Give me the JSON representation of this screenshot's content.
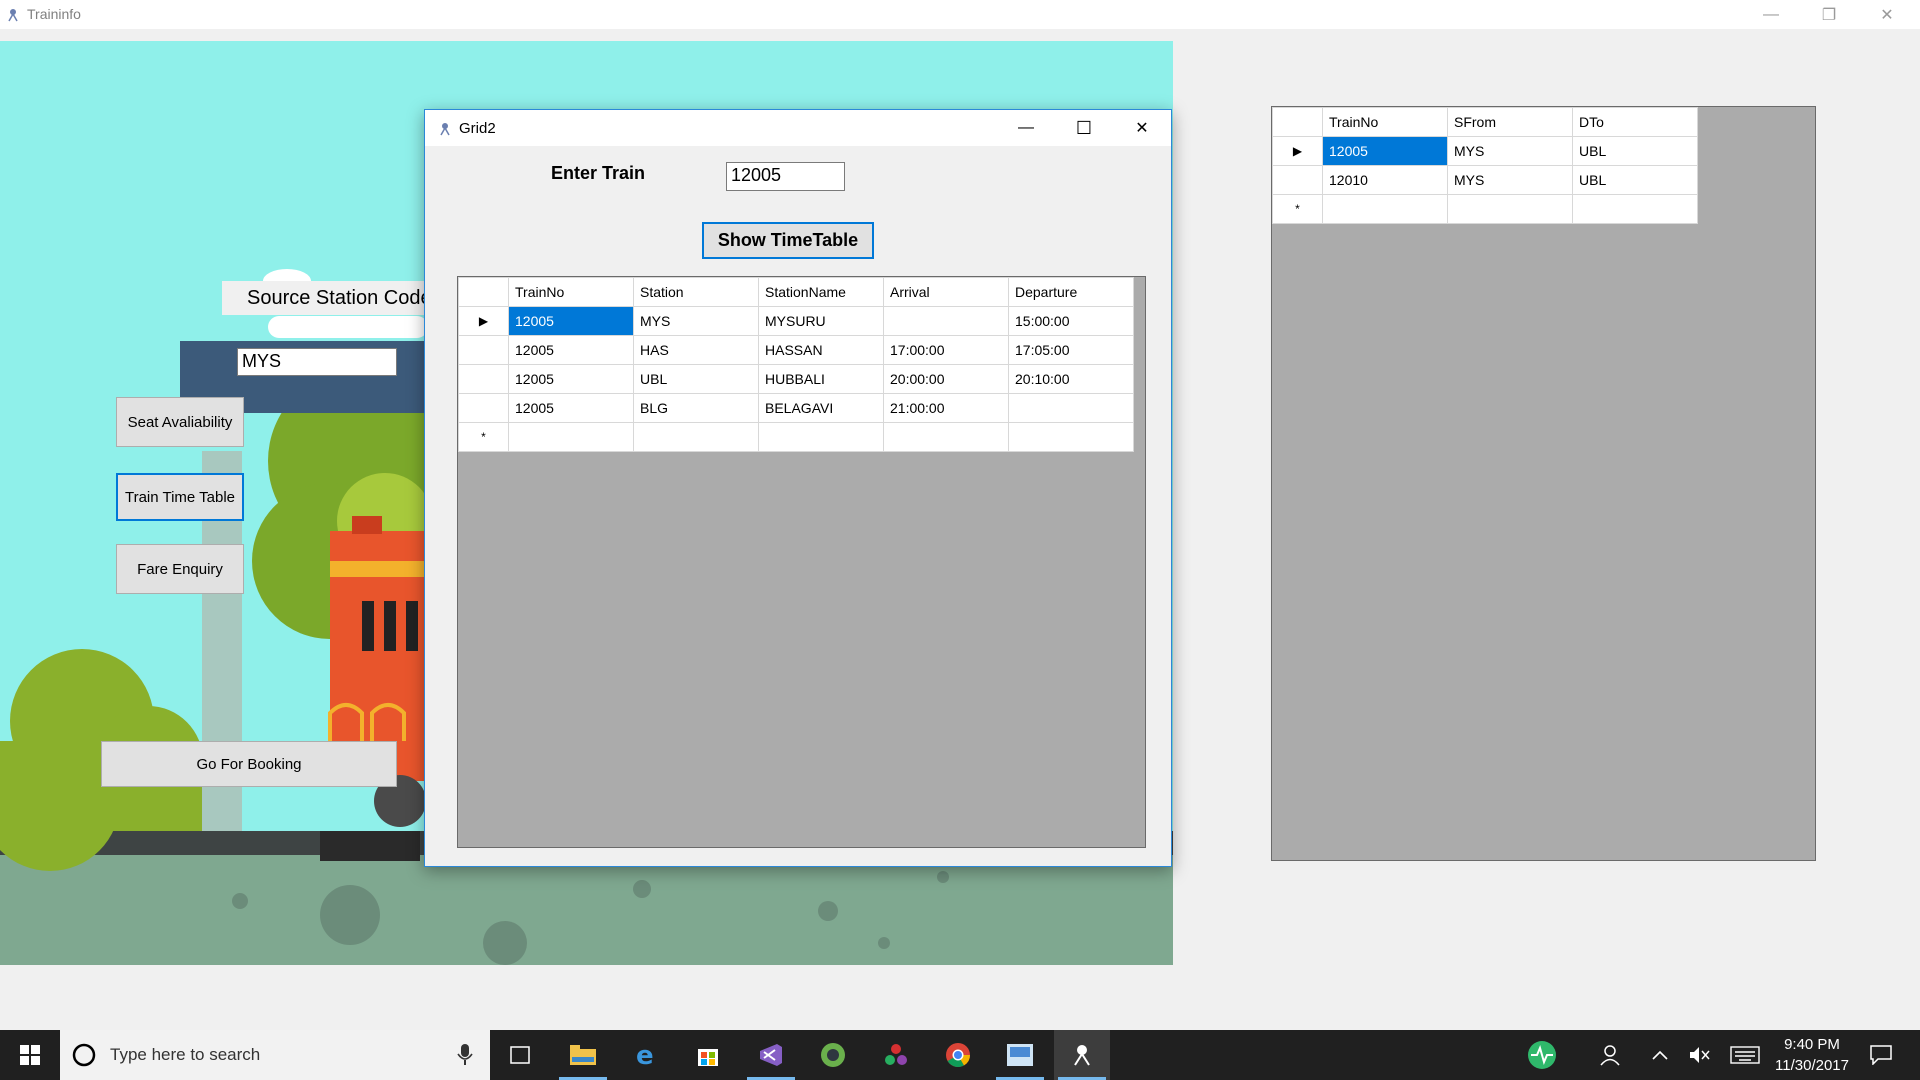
{
  "main_window": {
    "title": "Traininfo",
    "minimize_glyph": "—",
    "restore_glyph": "❐",
    "close_glyph": "✕"
  },
  "form": {
    "source_label": "Source Station Code",
    "source_value": "MYS",
    "buttons": {
      "seat": "Seat Avaliability",
      "timetable": "Train Time Table",
      "fare": "Fare Enquiry",
      "booking": "Go For Booking"
    }
  },
  "dialog": {
    "title": "Grid2",
    "enter_train_label": "Enter Train",
    "train_value": "12005",
    "show_button": "Show TimeTable",
    "minimize_glyph": "—",
    "maximize_glyph": "☐",
    "close_glyph": "✕",
    "grid": {
      "columns": [
        "TrainNo",
        "Station",
        "StationName",
        "Arrival",
        "Departure"
      ],
      "rows": [
        [
          "12005",
          "MYS",
          "MYSURU",
          "",
          "15:00:00"
        ],
        [
          "12005",
          "HAS",
          "HASSAN",
          "17:00:00",
          "17:05:00"
        ],
        [
          "12005",
          "UBL",
          "HUBBALI",
          "20:00:00",
          "20:10:00"
        ],
        [
          "12005",
          "BLG",
          "BELAGAVI",
          "21:00:00",
          ""
        ]
      ],
      "current_row_glyph": "▶",
      "new_row_glyph": "*"
    }
  },
  "right_grid": {
    "columns": [
      "TrainNo",
      "SFrom",
      "DTo"
    ],
    "rows": [
      [
        "12005",
        "MYS",
        "UBL"
      ],
      [
        "12010",
        "MYS",
        "UBL"
      ]
    ],
    "current_row_glyph": "▶",
    "new_row_glyph": "*"
  },
  "taskbar": {
    "search_placeholder": "Type here to search",
    "time": "9:40 PM",
    "date": "11/30/2017"
  },
  "colors": {
    "sky": "#8ff0ea",
    "selection": "#0078d7",
    "grid_background": "#ababab",
    "taskbar": "#202020"
  }
}
